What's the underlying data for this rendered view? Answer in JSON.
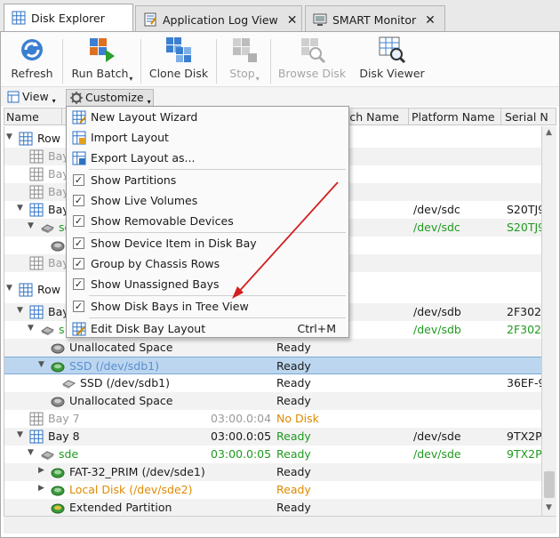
{
  "tabs": [
    {
      "label": "Disk Explorer",
      "active": true
    },
    {
      "label": "Application Log View",
      "active": false
    },
    {
      "label": "SMART Monitor",
      "active": false
    }
  ],
  "ribbon": {
    "refresh": "Refresh",
    "run_batch": "Run Batch",
    "clone_disk": "Clone Disk",
    "stop": "Stop",
    "browse_disk": "Browse Disk",
    "disk_viewer": "Disk Viewer"
  },
  "viewbar": {
    "view": "View",
    "customize": "Customize"
  },
  "columns": {
    "name": "Name",
    "batch_name": "Batch Name",
    "platform_name": "Platform Name",
    "serial": "Serial N"
  },
  "rows": [
    {
      "name": "Row 1",
      "status": "",
      "platform": "",
      "serial": "",
      "extra": ""
    },
    {
      "name": "Bay",
      "status": "",
      "platform": "",
      "serial": "",
      "extra": ""
    },
    {
      "name": "Bay",
      "status": "",
      "platform": "",
      "serial": "",
      "extra": ""
    },
    {
      "name": "Bay",
      "status": "",
      "platform": "",
      "serial": "",
      "extra": ""
    },
    {
      "name": "Bay",
      "status": "",
      "platform": "/dev/sdc",
      "serial": "S20TJ9",
      "extra": ""
    },
    {
      "name": "sd",
      "status": "",
      "platform": "/dev/sdc",
      "serial": "S20TJ9",
      "extra": ""
    },
    {
      "name": "",
      "status": "",
      "platform": "",
      "serial": "",
      "extra": ""
    },
    {
      "name": "Bay",
      "status": "",
      "platform": "",
      "serial": "",
      "extra": ""
    },
    {
      "name": "Row 2",
      "status": "",
      "platform": "",
      "serial": "",
      "extra": ""
    },
    {
      "name": "Bay",
      "status": "",
      "platform": "/dev/sdb",
      "serial": "2F302",
      "extra": ""
    },
    {
      "name": "s",
      "status": "",
      "platform": "/dev/sdb",
      "serial": "2F302",
      "extra": ""
    },
    {
      "name": "Unallocated Space",
      "status": "Ready",
      "platform": "",
      "serial": "",
      "extra": ""
    },
    {
      "name": "SSD (/dev/sdb1)",
      "status": "Ready",
      "platform": "",
      "serial": "",
      "extra": ""
    },
    {
      "name": "SSD (/dev/sdb1)",
      "status": "Ready",
      "platform": "",
      "serial": "36EF-9",
      "extra": ""
    },
    {
      "name": "Unallocated Space",
      "status": "Ready",
      "platform": "",
      "serial": "",
      "extra": ""
    },
    {
      "name": "Bay 7",
      "status": "No Disk",
      "platform": "",
      "serial": "",
      "extra": "03:00.0:04"
    },
    {
      "name": "Bay 8",
      "status": "Ready",
      "platform": "/dev/sde",
      "serial": "9TX2P",
      "extra": "03:00.0:05"
    },
    {
      "name": "sde",
      "status": "Ready",
      "platform": "/dev/sde",
      "serial": "9TX2P",
      "extra": "03:00.0:05"
    },
    {
      "name": "FAT-32_PRIM (/dev/sde1)",
      "status": "Ready",
      "platform": "",
      "serial": "",
      "extra": ""
    },
    {
      "name": "Local Disk (/dev/sde2)",
      "status": "Ready",
      "platform": "",
      "serial": "",
      "extra": ""
    },
    {
      "name": "Extended Partition",
      "status": "Ready",
      "platform": "",
      "serial": "",
      "extra": ""
    }
  ],
  "menu": {
    "items": [
      {
        "label": "New Layout Wizard"
      },
      {
        "label": "Import Layout"
      },
      {
        "label": "Export Layout as..."
      },
      {
        "label": "Show Partitions",
        "checked": true
      },
      {
        "label": "Show Live Volumes",
        "checked": true
      },
      {
        "label": "Show Removable Devices",
        "checked": true
      },
      {
        "label": "Show Device Item in Disk Bay",
        "checked": true
      },
      {
        "label": "Group by Chassis Rows",
        "checked": true
      },
      {
        "label": "Show Unassigned Bays",
        "checked": true
      },
      {
        "label": "Show Disk Bays in Tree View",
        "checked": true
      },
      {
        "label": "Edit Disk Bay Layout",
        "shortcut": "Ctrl+M"
      }
    ]
  },
  "colors": {
    "accent": "#2f72c4",
    "ready": "#1f9a1f",
    "warning": "#e08a00",
    "annotation_arrow": "#d22020",
    "selection": "#bcd6ef"
  }
}
